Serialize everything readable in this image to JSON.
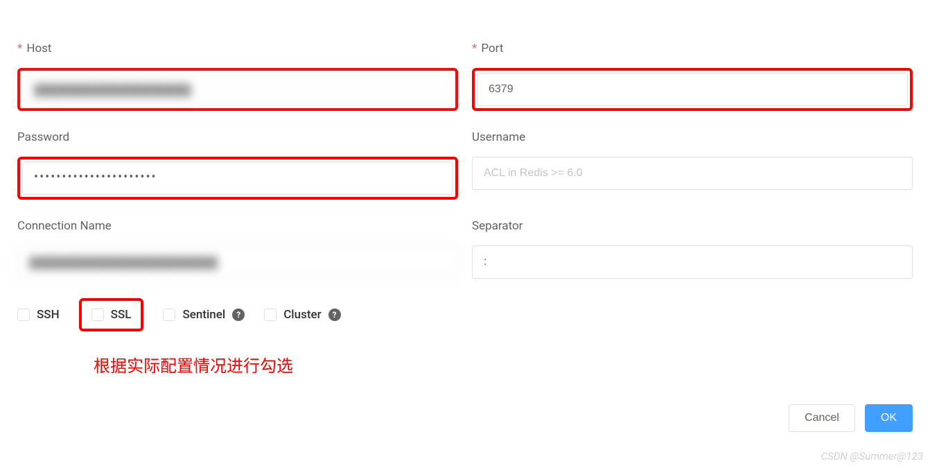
{
  "form": {
    "host": {
      "label": "Host",
      "value": ""
    },
    "port": {
      "label": "Port",
      "value": "6379"
    },
    "password": {
      "label": "Password",
      "value": "••••••••••••••••••••••"
    },
    "username": {
      "label": "Username",
      "placeholder": "ACL in Redis >= 6.0",
      "value": ""
    },
    "connection_name": {
      "label": "Connection Name",
      "value": ""
    },
    "separator": {
      "label": "Separator",
      "value": ":"
    }
  },
  "checkboxes": {
    "ssh": {
      "label": "SSH"
    },
    "ssl": {
      "label": "SSL"
    },
    "sentinel": {
      "label": "Sentinel"
    },
    "cluster": {
      "label": "Cluster"
    }
  },
  "annotation": "根据实际配置情况进行勾选",
  "buttons": {
    "cancel": "Cancel",
    "ok": "OK"
  },
  "watermark": "CSDN @Summer@123"
}
